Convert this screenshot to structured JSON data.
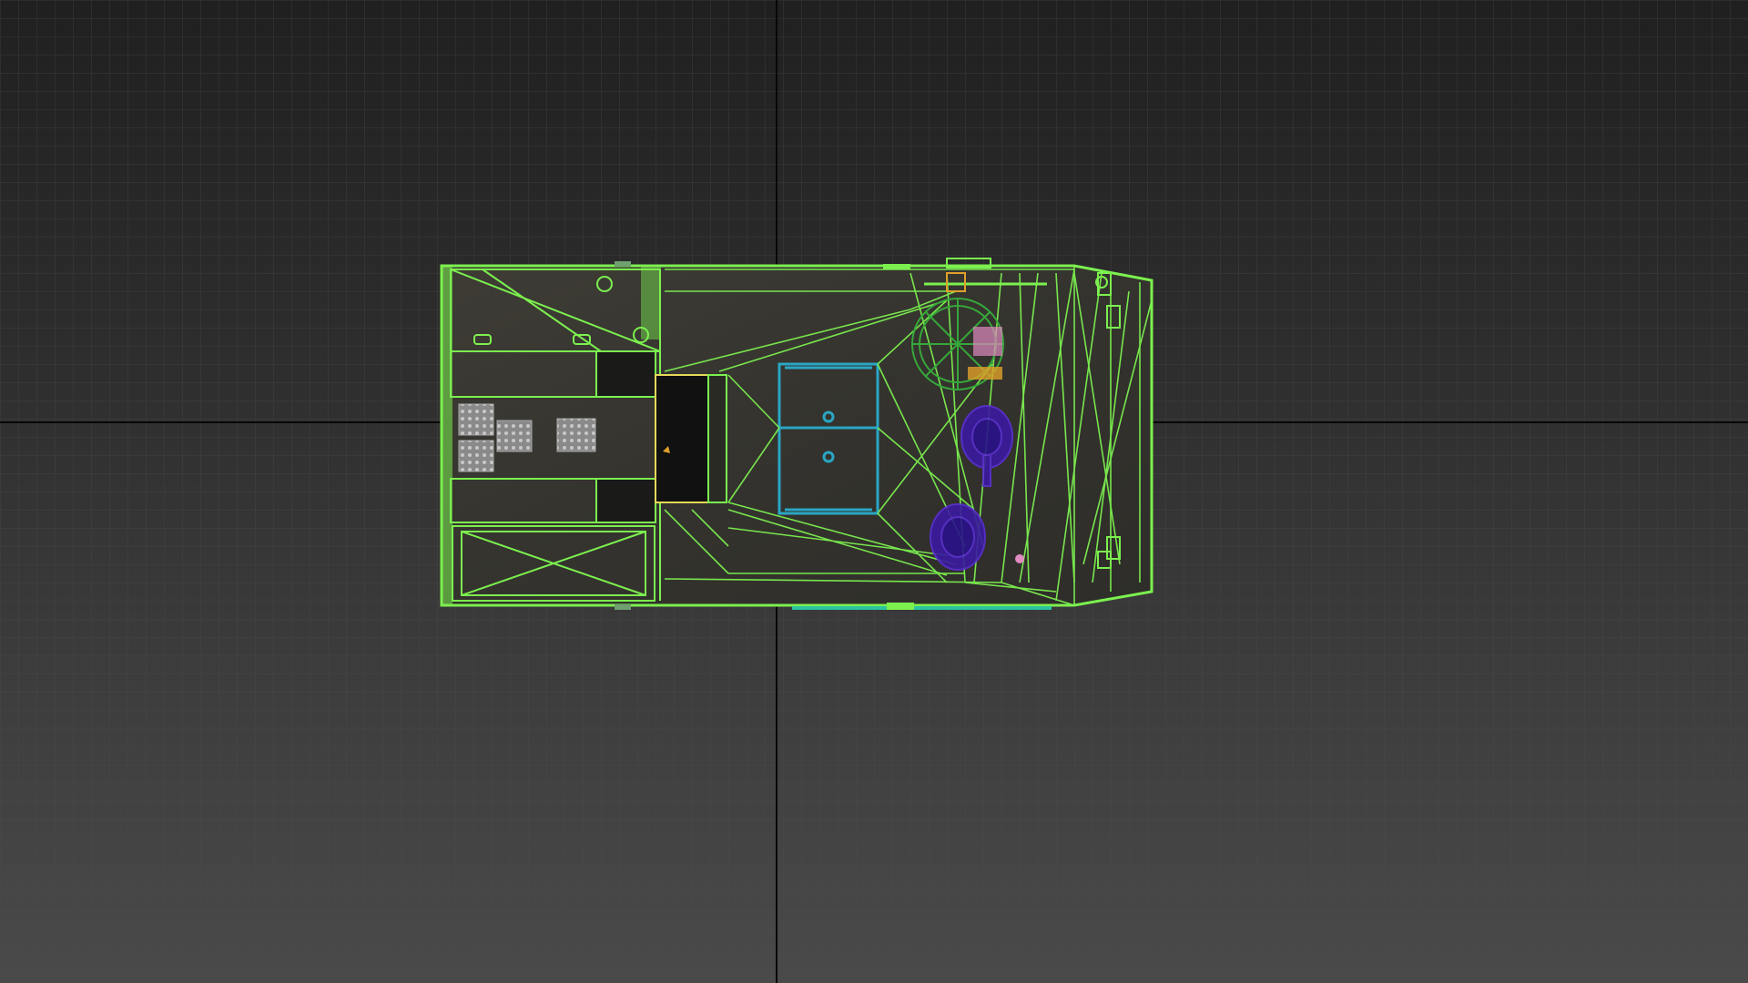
{
  "viewport": {
    "view": "top",
    "shading": "wireframe-over-textured",
    "grid_visible": true
  },
  "colors": {
    "background_top": "#202020",
    "background_bottom": "#4a4a4a",
    "grid_line": "#4e4e4e",
    "grid_major": "#0a0a0a",
    "wire_green": "#7cf04f",
    "wire_cyan": "#2aa6c4",
    "wire_purple": "#4a1fa8",
    "wire_orange": "#e0a02a",
    "wire_pink": "#e08ac0",
    "surface": "#3a3a34"
  },
  "scene": {
    "object": "vehicle-model",
    "selection_color": "wire_green"
  }
}
